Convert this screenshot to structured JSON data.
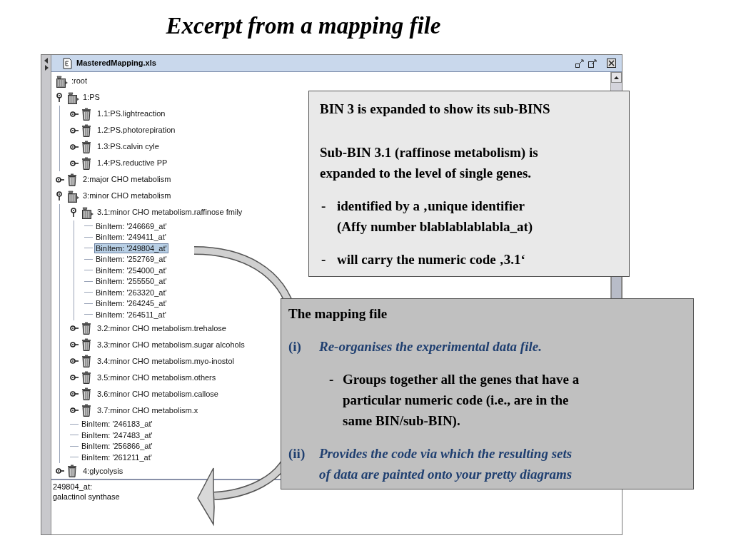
{
  "slide_title": "Excerpt from a mapping file",
  "window": {
    "title": "MasteredMapping.xls"
  },
  "tree": {
    "root": {
      "label": ":root",
      "kind": "root",
      "expanded": true,
      "children": [
        {
          "label": "1:PS",
          "kind": "bin",
          "expanded": true,
          "children": [
            {
              "label": "1.1:PS.lightreaction",
              "kind": "bin",
              "expanded": false
            },
            {
              "label": "1.2:PS.photorepiration",
              "kind": "bin",
              "expanded": false
            },
            {
              "label": "1.3:PS.calvin cyle",
              "kind": "bin",
              "expanded": false
            },
            {
              "label": "1.4:PS.reductive PP",
              "kind": "bin",
              "expanded": false
            }
          ]
        },
        {
          "label": "2:major CHO metabolism",
          "kind": "bin",
          "expanded": false
        },
        {
          "label": "3:minor CHO metabolism",
          "kind": "bin",
          "expanded": true,
          "children": [
            {
              "label": "3.1:minor CHO metabolism.raffinose fmily",
              "kind": "bin",
              "expanded": true,
              "children": [
                {
                  "label": "BinItem: '246669_at'",
                  "kind": "item",
                  "selected": false
                },
                {
                  "label": "BinItem: '249411_at'",
                  "kind": "item",
                  "selected": false
                },
                {
                  "label": "BinItem: '249804_at'",
                  "kind": "item",
                  "selected": true
                },
                {
                  "label": "BinItem: '252769_at'",
                  "kind": "item",
                  "selected": false
                },
                {
                  "label": "BinItem: '254000_at'",
                  "kind": "item",
                  "selected": false
                },
                {
                  "label": "BinItem: '255550_at'",
                  "kind": "item",
                  "selected": false
                },
                {
                  "label": "BinItem: '263320_at'",
                  "kind": "item",
                  "selected": false
                },
                {
                  "label": "BinItem: '264245_at'",
                  "kind": "item",
                  "selected": false
                },
                {
                  "label": "BinItem: '264511_at'",
                  "kind": "item",
                  "selected": false
                }
              ]
            },
            {
              "label": "3.2:minor CHO metabolism.trehalose",
              "kind": "bin",
              "expanded": false
            },
            {
              "label": "3.3:minor CHO metabolism.sugar alcohols",
              "kind": "bin",
              "expanded": false
            },
            {
              "label": "3.4:minor CHO metabolism.myo-inostol",
              "kind": "bin",
              "expanded": false
            },
            {
              "label": "3.5:minor CHO metabolism.others",
              "kind": "bin",
              "expanded": false
            },
            {
              "label": "3.6:minor CHO metabolism.callose",
              "kind": "bin",
              "expanded": false
            },
            {
              "label": "3.7:minor CHO metabolism.x",
              "kind": "bin",
              "expanded": false
            },
            {
              "label": "BinItem: '246183_at'",
              "kind": "item",
              "selected": false
            },
            {
              "label": "BinItem: '247483_at'",
              "kind": "item",
              "selected": false
            },
            {
              "label": "BinItem: '256866_at'",
              "kind": "item",
              "selected": false
            },
            {
              "label": "BinItem: '261211_at'",
              "kind": "item",
              "selected": false
            }
          ]
        },
        {
          "label": "4:glycolysis",
          "kind": "bin",
          "expanded": false
        }
      ]
    }
  },
  "detail_pane": {
    "lines": [
      "249804_at:",
      "galactinol synthase"
    ]
  },
  "callouts": [
    {
      "kind": "light",
      "paragraphs": [
        {
          "kind": "heading",
          "text": "BIN 3 is expanded to show its sub-BINS"
        },
        {
          "kind": "text",
          "text": "Sub-BIN 3.1 (raffinose metabolism) is\nexpanded to the level of single genes."
        },
        {
          "kind": "bullet",
          "marker": "-",
          "text": "identified by a ‚unique identifier\n(Affy number  blablablablabla_at)"
        },
        {
          "kind": "bullet",
          "marker": "-",
          "text": "will carry the numeric code ‚3.1‘"
        }
      ]
    },
    {
      "kind": "dark",
      "paragraphs": [
        {
          "kind": "title",
          "text": "The mapping file"
        },
        {
          "kind": "numbered",
          "marker": "(i)",
          "text": "Re-organises the experimental data file."
        },
        {
          "kind": "sub_bullet",
          "marker": "-",
          "text": "Groups together all the genes that have a\nparticular  numeric code (i.e., are in the\nsame BIN/sub-BIN)."
        },
        {
          "kind": "numbered",
          "marker": "(ii)",
          "text": "Provides the code via which the resulting sets\nof data are painted onto your pretty diagrams"
        }
      ]
    }
  ]
}
